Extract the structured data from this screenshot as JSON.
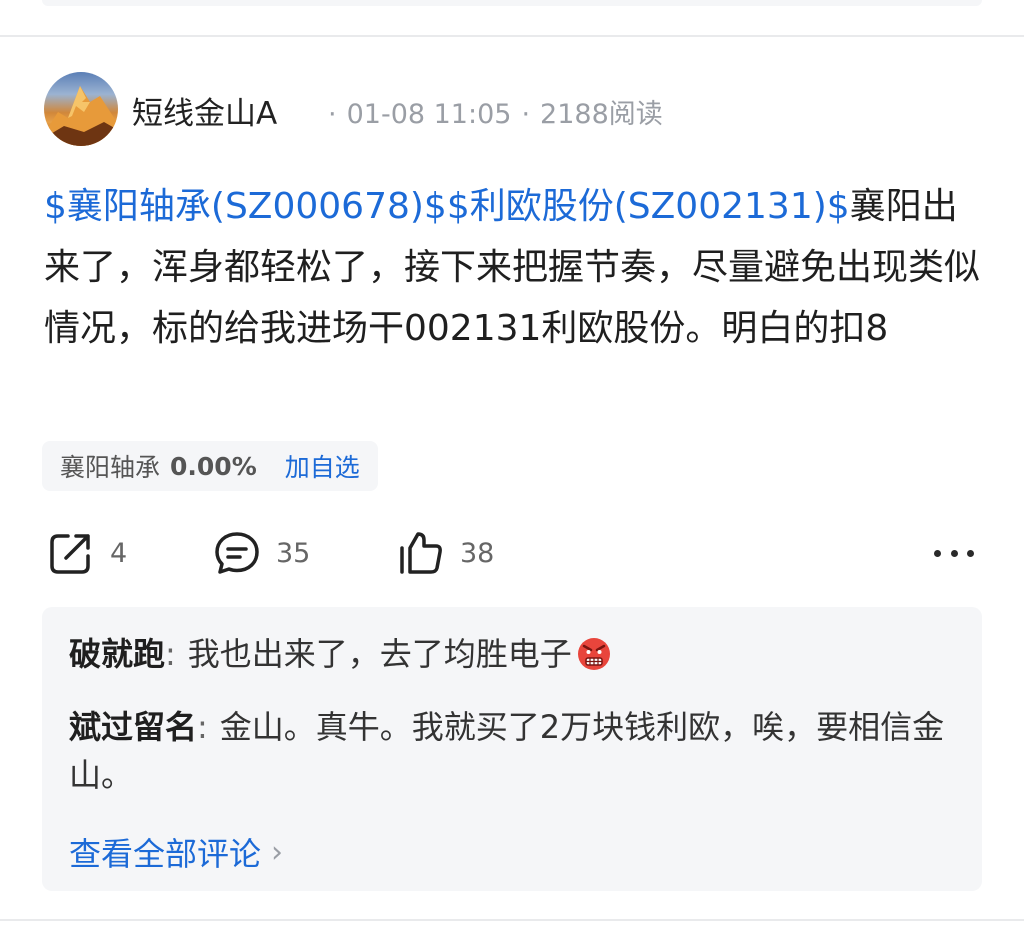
{
  "post": {
    "author": "短线金山A",
    "date": "01-08 11:05",
    "views": "2188阅读",
    "stock_tag_1": "$襄阳轴承(SZ000678)$",
    "stock_tag_2": "$利欧股份(SZ002131)$",
    "body": "襄阳出来了，浑身都轻松了，接下来把握节奏，尽量避免出现类似情况，标的给我进场干002131利欧股份。明白的扣8"
  },
  "stock_chip": {
    "name": "襄阳轴承",
    "change": "0.00%",
    "add_label": "加自选"
  },
  "actions": {
    "share_count": "4",
    "comment_count": "35",
    "like_count": "38"
  },
  "comments": [
    {
      "author": "破就跑",
      "separator": ":",
      "text": "我也出来了，去了均胜电子",
      "emoji": "angry-face-emoji"
    },
    {
      "author": "斌过留名",
      "separator": ":",
      "text": "金山。真牛。我就买了2万块钱利欧，唉，要相信金山。"
    }
  ],
  "view_all_label": "查看全部评论",
  "colors": {
    "link_blue": "#1c6ad7",
    "muted_gray": "#9a9ea5",
    "panel_bg": "#f5f6f8"
  }
}
